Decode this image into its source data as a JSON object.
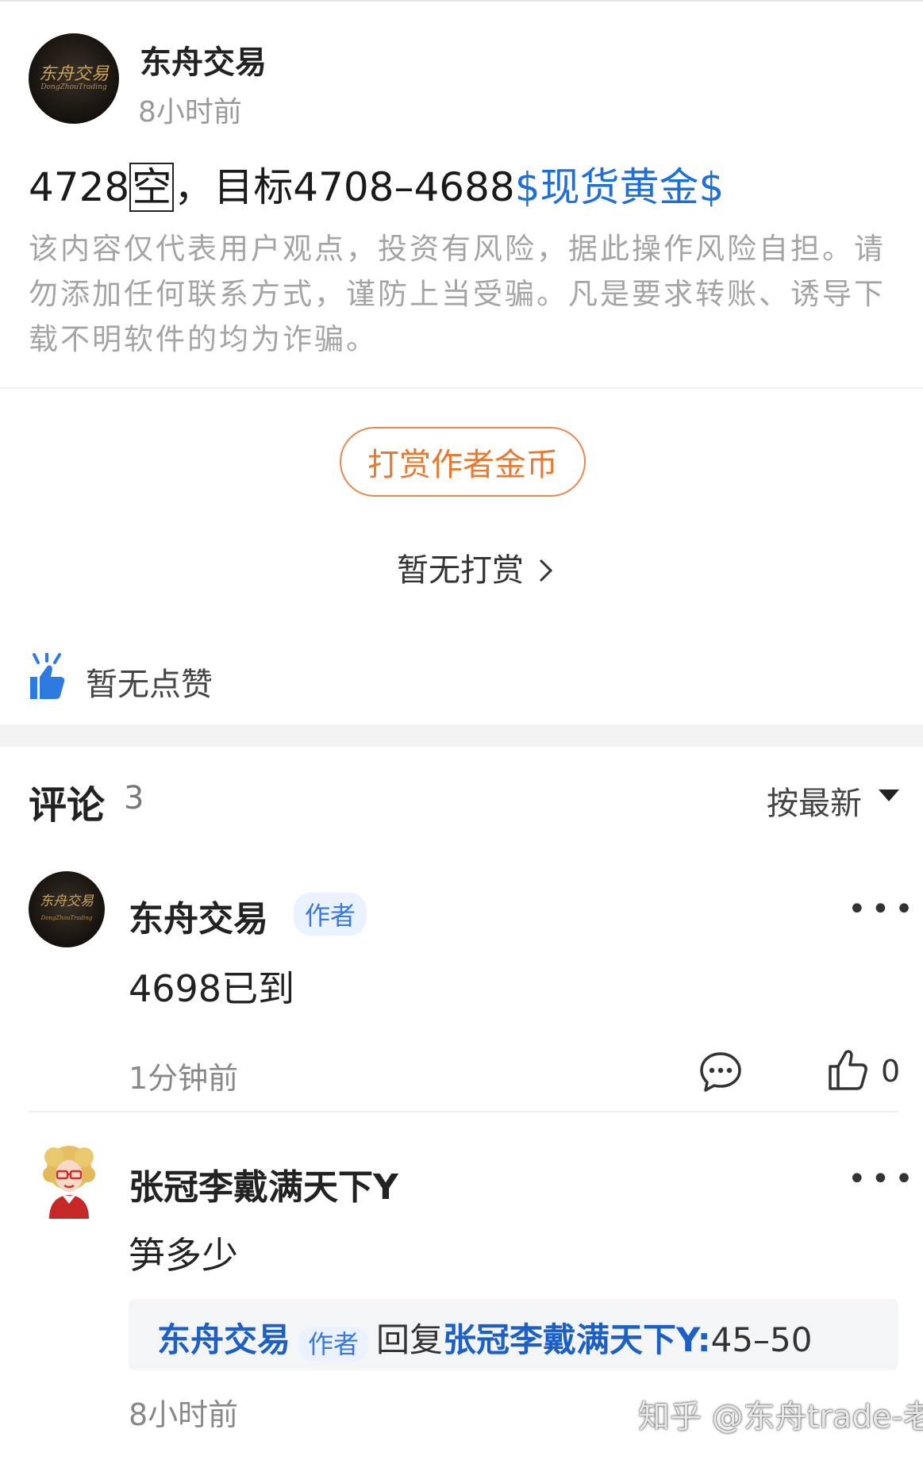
{
  "post": {
    "author": "东舟交易",
    "avatar_text": "东舟交易",
    "avatar_subtext": "DongZhouTrading",
    "time": "8小时前",
    "text_prefix": "4728",
    "text_box_char": "空",
    "text_middle": "，目标4708–4688",
    "tag": "$现货黄金$",
    "disclaimer": "该内容仅代表用户观点，投资有风险，据此操作风险自担。请勿添加任何联系方式，谨防上当受骗。凡是要求转账、诱导下载不明软件的均为诈骗。"
  },
  "tipping": {
    "button_label": "打赏作者金币",
    "no_tip_label": "暂无打赏"
  },
  "likes": {
    "label": "暂无点赞"
  },
  "comments": {
    "title": "评论",
    "count": "3",
    "sort_label": "按最新",
    "items": [
      {
        "name": "东舟交易",
        "badge": "作者",
        "avatar_text": "东舟交易",
        "avatar_subtext": "DongZhouTrading",
        "body": "4698已到",
        "time": "1分钟前",
        "like_count": "0"
      },
      {
        "name": "张冠李戴满天下Y",
        "body": "笋多少",
        "time": "8小时前",
        "reply": {
          "author": "东舟交易",
          "badge": "作者",
          "verb": "回复",
          "target": "张冠李戴满天下Y:",
          "text": "45–50"
        }
      }
    ]
  },
  "watermark": "知乎 @东舟trade-老A",
  "colors": {
    "accent_blue": "#1e6fd6",
    "tip_orange": "#e67a33",
    "muted": "#a4a4a4"
  }
}
